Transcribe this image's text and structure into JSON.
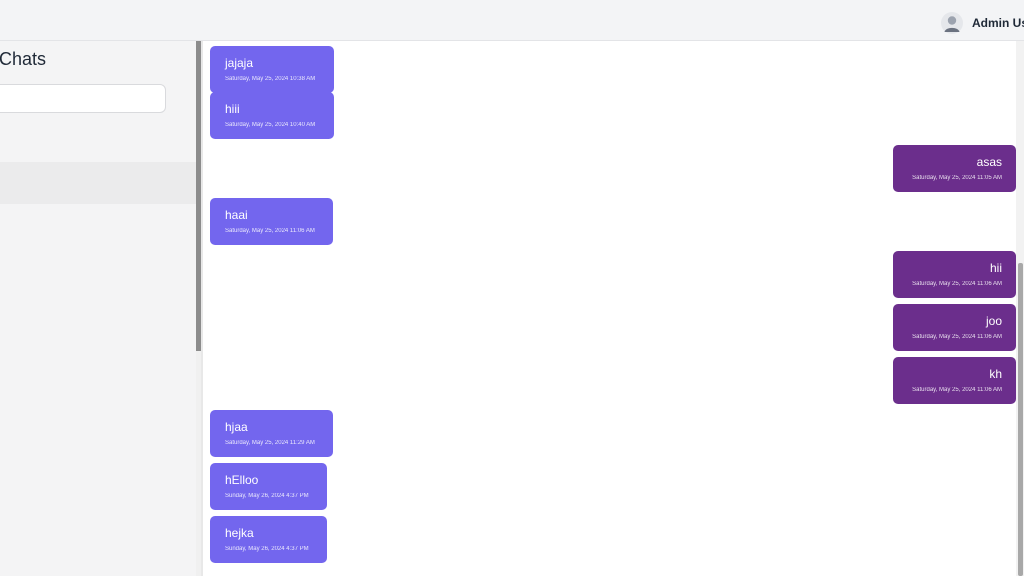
{
  "header": {
    "user_name": "Admin User",
    "avatar_icon": "user-avatar-icon"
  },
  "sidebar": {
    "title": "Chats",
    "search_value": "",
    "search_placeholder": ""
  },
  "colors": {
    "incoming_bubble": "#7366ee",
    "outgoing_bubble": "#6b2e8c"
  },
  "messages": [
    {
      "direction": "incoming",
      "text": "jajaja",
      "time": "Saturday, May 25, 2024 10:38 AM"
    },
    {
      "direction": "incoming",
      "text": "hiii",
      "time": "Saturday, May 25, 2024 10:40 AM"
    },
    {
      "direction": "outgoing",
      "text": "asas",
      "time": "Saturday, May 25, 2024 11:05 AM"
    },
    {
      "direction": "incoming",
      "text": "haai",
      "time": "Saturday, May 25, 2024 11:06 AM"
    },
    {
      "direction": "outgoing",
      "text": "hii",
      "time": "Saturday, May 25, 2024 11:06 AM"
    },
    {
      "direction": "outgoing",
      "text": "joo",
      "time": "Saturday, May 25, 2024 11:06 AM"
    },
    {
      "direction": "outgoing",
      "text": "kh",
      "time": "Saturday, May 25, 2024 11:06 AM"
    },
    {
      "direction": "incoming",
      "text": "hjaa",
      "time": "Saturday, May 25, 2024 11:29 AM"
    },
    {
      "direction": "incoming",
      "text": "hElloo",
      "time": "Sunday, May 26, 2024 4:37 PM"
    },
    {
      "direction": "incoming",
      "text": "hejka",
      "time": "Sunday, May 26, 2024 4:37 PM"
    }
  ]
}
